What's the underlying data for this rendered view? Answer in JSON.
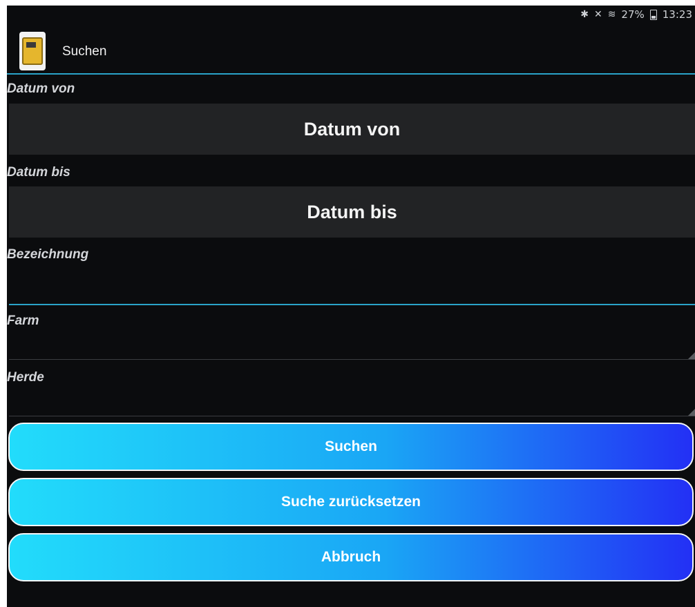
{
  "status_bar": {
    "bluetooth_icon": "bluetooth-icon",
    "mute_icon": "mute-icon",
    "wifi_icon": "wifi-icon",
    "battery_percent": "27%",
    "battery_icon": "battery-icon",
    "time": "13:23"
  },
  "app_bar": {
    "app_icon": "app-logo-device-icon",
    "title": "Suchen"
  },
  "form": {
    "date_from": {
      "label": "Datum von",
      "button_label": "Datum von"
    },
    "date_to": {
      "label": "Datum bis",
      "button_label": "Datum bis"
    },
    "bezeichnung": {
      "label": "Bezeichnung",
      "value": ""
    },
    "farm": {
      "label": "Farm",
      "value": ""
    },
    "herde": {
      "label": "Herde",
      "value": ""
    }
  },
  "actions": {
    "search_label": "Suchen",
    "reset_label": "Suche zurücksetzen",
    "cancel_label": "Abbruch"
  },
  "colors": {
    "background": "#0b0c0e",
    "accent_line": "#2aa3c9",
    "button_gradient_start": "#22dcfb",
    "button_gradient_end": "#2330f5"
  }
}
